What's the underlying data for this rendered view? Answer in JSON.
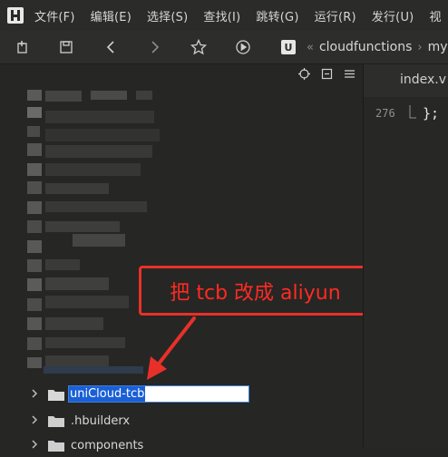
{
  "menubar": {
    "items": [
      "文件(F)",
      "编辑(E)",
      "选择(S)",
      "查找(I)",
      "跳转(G)",
      "运行(R)",
      "发行(U)",
      "视"
    ]
  },
  "breadcrumb": {
    "badge": "U",
    "sep1": "«",
    "folder": "cloudfunctions",
    "sep2": "›",
    "next": "my"
  },
  "tree": {
    "rename_value": "uniCloud-tcb",
    "items": [
      ".hbuilderx",
      "components"
    ]
  },
  "annotation": {
    "text": "把 tcb 改成 aliyun"
  },
  "editor": {
    "tab_label": "index.v",
    "line_number": "276",
    "code": "};"
  },
  "colors": {
    "annotation_red": "#e8302a",
    "selection_blue": "#1a5fd6"
  }
}
